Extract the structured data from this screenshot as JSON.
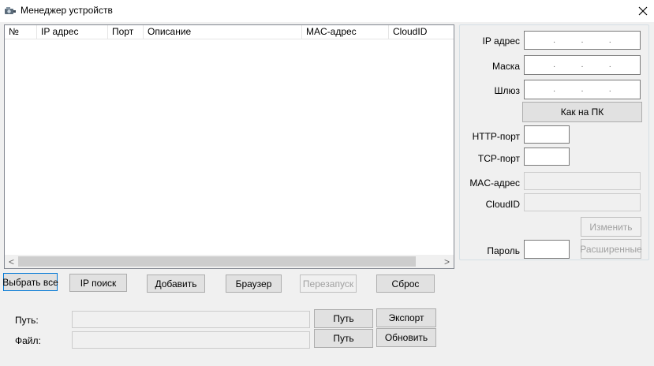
{
  "window": {
    "title": "Менеджер устройств",
    "close_glyph": "✕"
  },
  "device_list": {
    "columns": [
      "№",
      "IP адрес",
      "Порт",
      "Описание",
      "MAC-адрес",
      "CloudID",
      ""
    ],
    "rows": [],
    "scroll_left": "<",
    "scroll_right": ">"
  },
  "actions": {
    "select_all": "Выбрать все",
    "ip_search": "IP поиск",
    "add": "Добавить",
    "browser": "Браузер",
    "restart": "Перезапуск",
    "reset": "Сброс"
  },
  "settings": {
    "ip_label": "IP адрес",
    "ip_dots": [
      ".",
      ".",
      "."
    ],
    "mask_label": "Маска",
    "mask_dots": [
      ".",
      ".",
      "."
    ],
    "gateway_label": "Шлюз",
    "gateway_dots": [
      ".",
      ".",
      "."
    ],
    "same_as_pc": "Как на ПК",
    "http_port_label": "HTTP-порт",
    "http_port_value": "",
    "tcp_port_label": "TCP-порт",
    "tcp_port_value": "",
    "mac_label": "MAC-адрес",
    "mac_value": "",
    "cloudid_label": "CloudID",
    "cloudid_value": "",
    "modify": "Изменить",
    "password_label": "Пароль",
    "password_value": "",
    "advanced": "Расширенные"
  },
  "bottom": {
    "path_label": "Путь:",
    "path_value": "",
    "path_browse": "Путь",
    "export": "Экспорт",
    "file_label": "Файл:",
    "file_value": "",
    "file_browse": "Путь",
    "update": "Обновить"
  }
}
